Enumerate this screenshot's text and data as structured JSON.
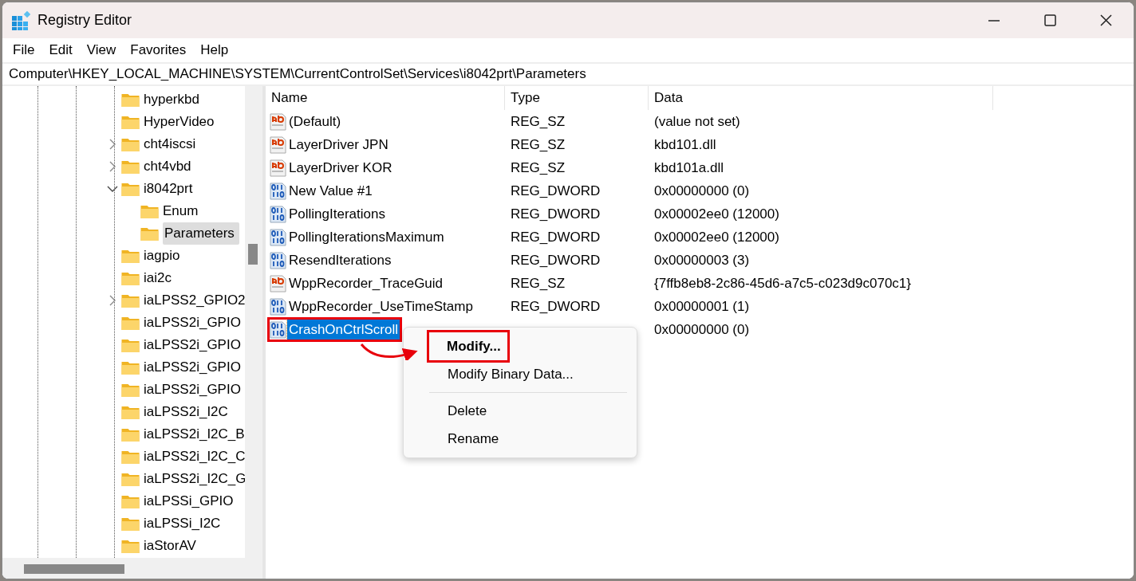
{
  "window": {
    "title": "Registry Editor"
  },
  "menu_bar": [
    "File",
    "Edit",
    "View",
    "Favorites",
    "Help"
  ],
  "address_bar": "Computer\\HKEY_LOCAL_MACHINE\\SYSTEM\\CurrentControlSet\\Services\\i8042prt\\Parameters",
  "tree": [
    {
      "label": "hyperkbd",
      "kind": "leaf",
      "selected": false
    },
    {
      "label": "HyperVideo",
      "kind": "leaf",
      "selected": false
    },
    {
      "label": "cht4iscsi",
      "kind": "branch",
      "expanded": false,
      "selected": false
    },
    {
      "label": "cht4vbd",
      "kind": "branch",
      "expanded": false,
      "selected": false
    },
    {
      "label": "i8042prt",
      "kind": "branch",
      "expanded": true,
      "selected": false,
      "children": [
        {
          "label": "Enum",
          "kind": "leaf",
          "selected": false
        },
        {
          "label": "Parameters",
          "kind": "leaf",
          "selected": true
        }
      ]
    },
    {
      "label": "iagpio",
      "kind": "leaf",
      "selected": false
    },
    {
      "label": "iai2c",
      "kind": "leaf",
      "selected": false
    },
    {
      "label": "iaLPSS2_GPIO2",
      "kind": "branch",
      "expanded": false,
      "selected": false
    },
    {
      "label": "iaLPSS2i_GPIO",
      "kind": "leaf",
      "selected": false
    },
    {
      "label": "iaLPSS2i_GPIO",
      "kind": "leaf",
      "selected": false
    },
    {
      "label": "iaLPSS2i_GPIO",
      "kind": "leaf",
      "selected": false
    },
    {
      "label": "iaLPSS2i_GPIO",
      "kind": "leaf",
      "selected": false
    },
    {
      "label": "iaLPSS2i_I2C",
      "kind": "leaf",
      "selected": false
    },
    {
      "label": "iaLPSS2i_I2C_B",
      "kind": "leaf",
      "selected": false
    },
    {
      "label": "iaLPSS2i_I2C_C",
      "kind": "leaf",
      "selected": false
    },
    {
      "label": "iaLPSS2i_I2C_G",
      "kind": "leaf",
      "selected": false
    },
    {
      "label": "iaLPSSi_GPIO",
      "kind": "leaf",
      "selected": false
    },
    {
      "label": "iaLPSSi_I2C",
      "kind": "leaf",
      "selected": false
    },
    {
      "label": "iaStorAV",
      "kind": "leaf",
      "selected": false
    }
  ],
  "table": {
    "columns": [
      "Name",
      "Type",
      "Data"
    ],
    "rows": [
      {
        "kind": "string",
        "name": "(Default)",
        "type": "REG_SZ",
        "data": "(value not set)",
        "selected": false,
        "highlighted": false
      },
      {
        "kind": "string",
        "name": "LayerDriver JPN",
        "type": "REG_SZ",
        "data": "kbd101.dll",
        "selected": false,
        "highlighted": false
      },
      {
        "kind": "string",
        "name": "LayerDriver KOR",
        "type": "REG_SZ",
        "data": "kbd101a.dll",
        "selected": false,
        "highlighted": false
      },
      {
        "kind": "binary",
        "name": "New Value #1",
        "type": "REG_DWORD",
        "data": "0x00000000 (0)",
        "selected": false,
        "highlighted": false
      },
      {
        "kind": "binary",
        "name": "PollingIterations",
        "type": "REG_DWORD",
        "data": "0x00002ee0 (12000)",
        "selected": false,
        "highlighted": false
      },
      {
        "kind": "binary",
        "name": "PollingIterationsMaximum",
        "type": "REG_DWORD",
        "data": "0x00002ee0 (12000)",
        "selected": false,
        "highlighted": false
      },
      {
        "kind": "binary",
        "name": "ResendIterations",
        "type": "REG_DWORD",
        "data": "0x00000003 (3)",
        "selected": false,
        "highlighted": false
      },
      {
        "kind": "string",
        "name": "WppRecorder_TraceGuid",
        "type": "REG_SZ",
        "data": "{7ffb8eb8-2c86-45d6-a7c5-c023d9c070c1}",
        "selected": false,
        "highlighted": false
      },
      {
        "kind": "binary",
        "name": "WppRecorder_UseTimeStamp",
        "type": "REG_DWORD",
        "data": "0x00000001 (1)",
        "selected": false,
        "highlighted": false
      },
      {
        "kind": "binary",
        "name": "CrashOnCtrlScroll",
        "data": "0x00000000 (0)",
        "selected": true,
        "highlighted": true
      }
    ]
  },
  "context_menu": [
    {
      "kind": "item",
      "label": "Modify...",
      "default": true,
      "highlighted": true
    },
    {
      "kind": "item",
      "label": "Modify Binary Data...",
      "default": false,
      "highlighted": false
    },
    {
      "kind": "separator"
    },
    {
      "kind": "item",
      "label": "Delete",
      "default": false,
      "highlighted": false
    },
    {
      "kind": "item",
      "label": "Rename",
      "default": false,
      "highlighted": false
    }
  ]
}
